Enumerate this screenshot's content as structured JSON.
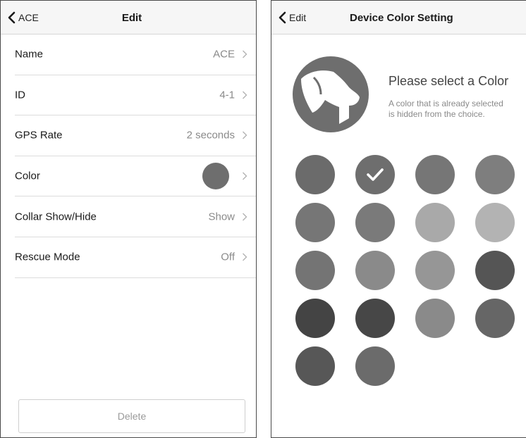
{
  "edit_screen": {
    "back_label": "ACE",
    "title": "Edit",
    "rows": [
      {
        "label": "Name",
        "value": "ACE"
      },
      {
        "label": "ID",
        "value": "4-1"
      },
      {
        "label": "GPS Rate",
        "value": "2 seconds"
      },
      {
        "label": "Color",
        "value": ""
      },
      {
        "label": "Collar Show/Hide",
        "value": "Show"
      },
      {
        "label": "Rescue Mode",
        "value": "Off"
      }
    ],
    "current_color": "#6e6e6e",
    "delete_label": "Delete"
  },
  "color_screen": {
    "back_label": "Edit",
    "title": "Device Color Setting",
    "heading": "Please select a Color",
    "subtext_line1": "A color that is already selected",
    "subtext_line2": "is hidden from the choice.",
    "avatar_icon": "dog-head-icon",
    "selected_index": 1,
    "swatches": [
      "#6b6b6b",
      "#6e6e6e",
      "#767676",
      "#7e7e7e",
      "#767676",
      "#7a7a7a",
      "#a9a9a9",
      "#b3b3b3",
      "#747474",
      "#8a8a8a",
      "#969696",
      "#555555",
      "#444444",
      "#474747",
      "#8a8a8a",
      "#666666",
      "#575757",
      "#6b6b6b"
    ]
  }
}
